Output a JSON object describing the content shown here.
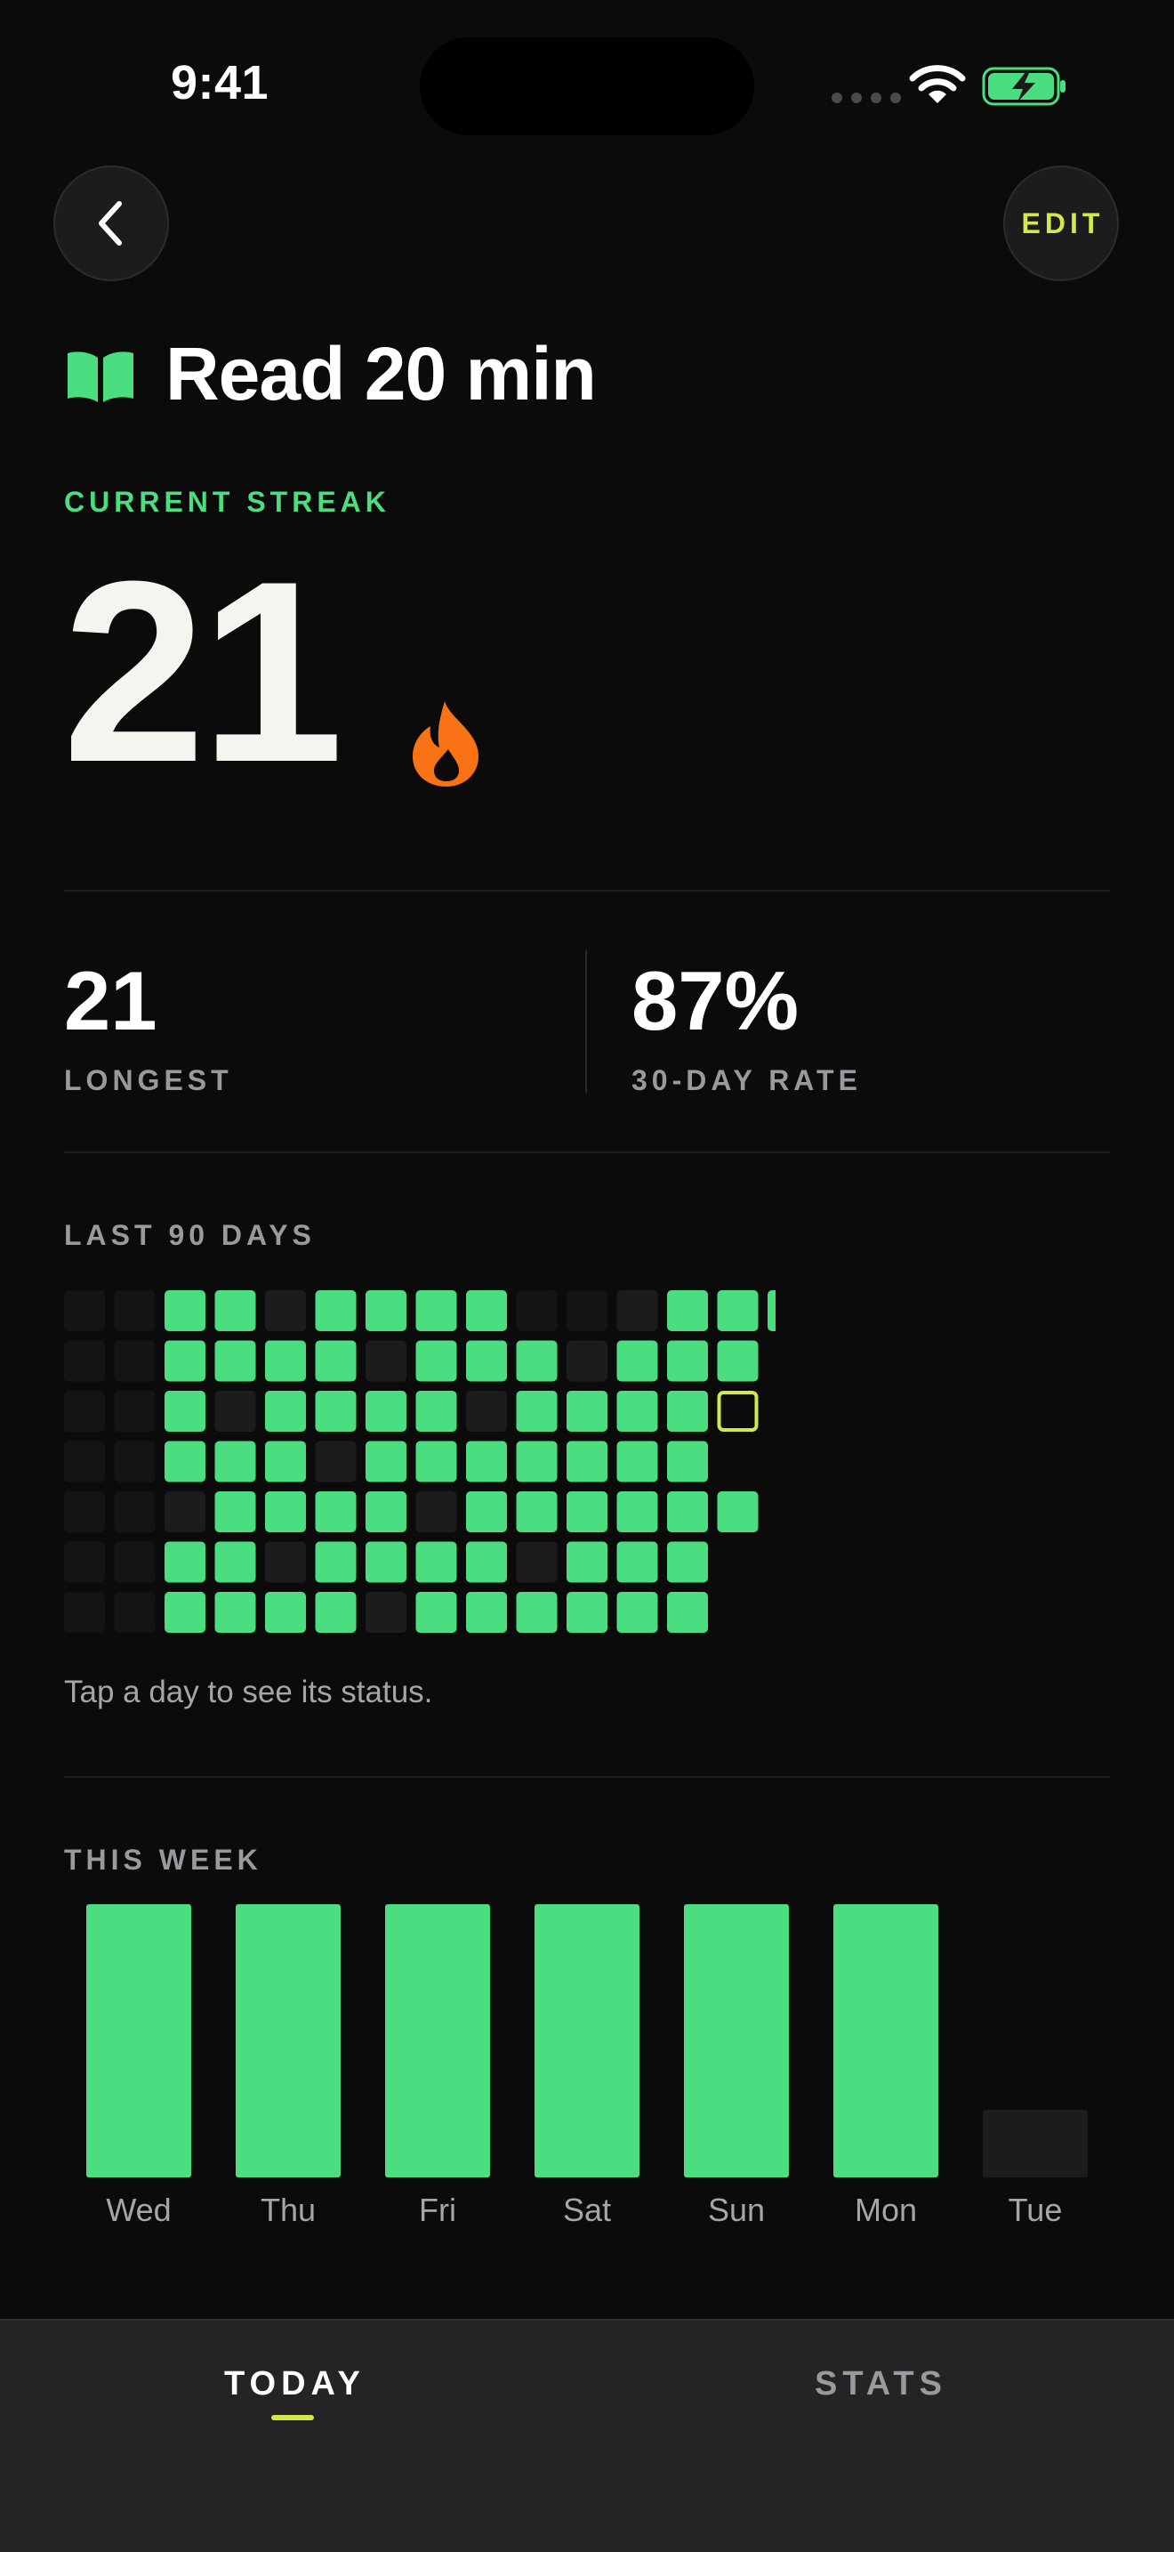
{
  "status_bar": {
    "time": "9:41"
  },
  "header": {
    "edit_label": "EDIT",
    "back_icon": "chevron-left-icon"
  },
  "habit": {
    "title": "Read 20 min",
    "icon": "book-open-icon"
  },
  "current_streak": {
    "label": "CURRENT STREAK",
    "value": "21",
    "icon": "flame-icon"
  },
  "stats": {
    "longest_value": "21",
    "longest_label": "LONGEST",
    "rate_value": "87%",
    "rate_label": "30-DAY RATE"
  },
  "heatmap": {
    "label": "LAST 90 DAYS",
    "hint": "Tap a day to see its status.",
    "grid_rows": [
      "ffdd-ddddff-ddd",
      "ffdddd-ddd-ddd",
      "ffd-dddd-dddds",
      "ffddd-ddddddd",
      "ff-dddd-dddddd",
      "ffdd-dddd-ddd",
      "ffdddd-dddddd"
    ],
    "legend": {
      "f": "no data",
      "d": "done",
      "-": "missed",
      "s": "today (selected)"
    },
    "colors": {
      "done": "#4ade80",
      "missed": "#1c1c1e",
      "future": "#141416",
      "today_outline": "#d4e84a"
    }
  },
  "chart_data": {
    "type": "bar",
    "title": "THIS WEEK",
    "categories": [
      "Wed",
      "Thu",
      "Fri",
      "Sat",
      "Sun",
      "Mon",
      "Tue"
    ],
    "values": [
      1,
      1,
      1,
      1,
      1,
      1,
      0
    ],
    "ylim": [
      0,
      1
    ],
    "colors": {
      "done": "#4ade80",
      "pending": "#1c1c1e"
    }
  },
  "tabbar": {
    "today": "TODAY",
    "stats": "STATS"
  },
  "colors": {
    "accent_green": "#4ade80",
    "accent_lime": "#d4e84a",
    "flame_orange": "#f97316",
    "background": "#0b0b0c"
  }
}
